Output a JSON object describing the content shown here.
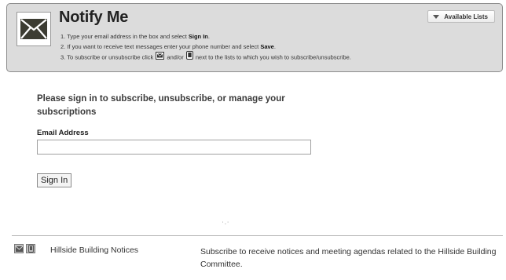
{
  "header": {
    "title": "Notify Me",
    "step1_text": "1. Type your email address in the box and select ",
    "step1_bold": "Sign In",
    "step1_end": ".",
    "step2_text": "2. If you want to receive text messages enter your phone number and select ",
    "step2_bold": "Save",
    "step2_end": ".",
    "step3_text_a": "3. To subscribe or unsubscribe click ",
    "step3_text_b": " and/or ",
    "step3_text_c": " next to the lists to which you wish to subscribe/unsubscribe.",
    "available_lists_label": "Available Lists"
  },
  "signin": {
    "heading": "Please sign in to subscribe, unsubscribe, or manage your subscriptions",
    "email_label": "Email Address",
    "email_value": "",
    "button_label": "Sign In"
  },
  "stray_text": "' - '",
  "lists": [
    {
      "name": "Hillside Building Notices",
      "description": "Subscribe to receive notices and meeting agendas related to the Hillside Building Committee."
    }
  ],
  "colors": {
    "panel_bg": "#dcdcdc",
    "envelope": "#3c3c32",
    "text": "#333333"
  },
  "icons": [
    "envelope-icon",
    "phone-icon",
    "dropdown-triangle-icon"
  ]
}
